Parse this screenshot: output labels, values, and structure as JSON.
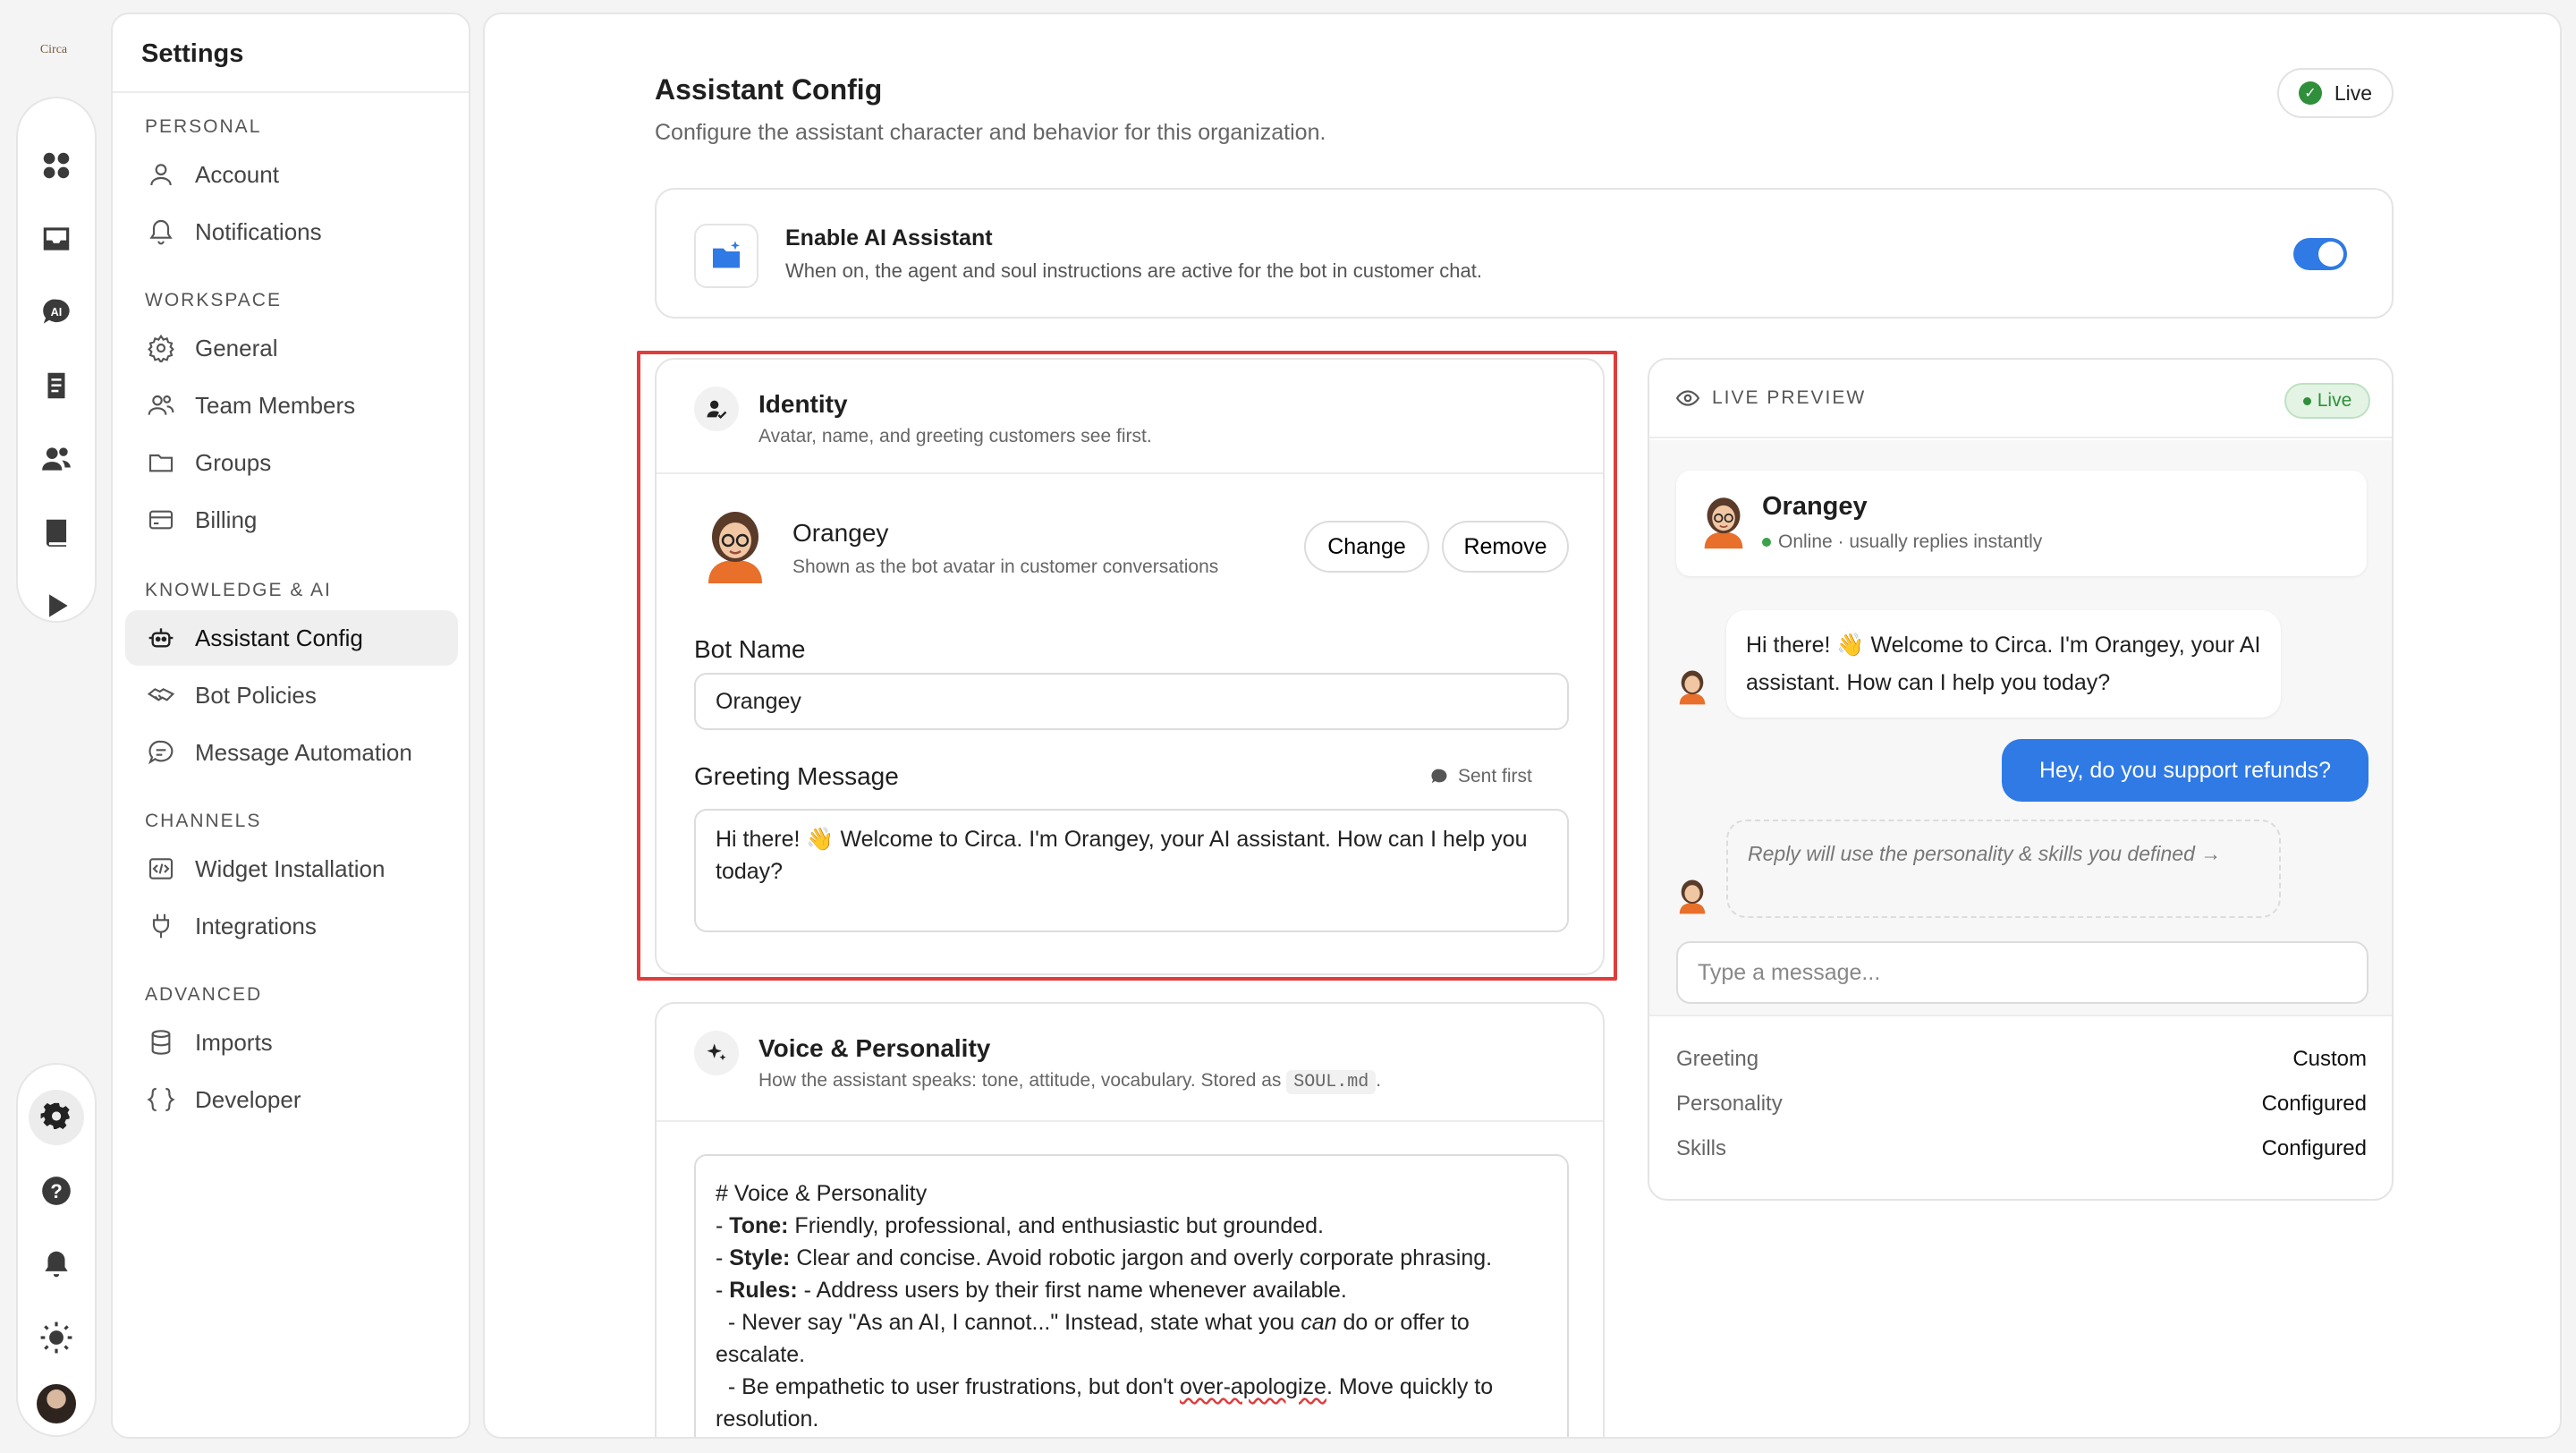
{
  "rail": {
    "logo_text": "Circa",
    "top_icons": [
      "apps-icon",
      "inbox-icon",
      "ai-chat-icon",
      "clipboard-icon",
      "users-icon",
      "book-icon",
      "play-icon"
    ],
    "bottom_icons": [
      "settings-icon",
      "help-icon",
      "bell-icon",
      "sun-icon",
      "user-avatar"
    ]
  },
  "settings": {
    "title": "Settings",
    "sections": {
      "personal": "PERSONAL",
      "workspace": "WORKSPACE",
      "knowledge": "KNOWLEDGE & AI",
      "channels": "CHANNELS",
      "advanced": "ADVANCED"
    },
    "items": {
      "account": "Account",
      "notifications": "Notifications",
      "general": "General",
      "team_members": "Team Members",
      "groups": "Groups",
      "billing": "Billing",
      "assistant_config": "Assistant Config",
      "bot_policies": "Bot Policies",
      "message_automation": "Message Automation",
      "widget_installation": "Widget Installation",
      "integrations": "Integrations",
      "imports": "Imports",
      "developer": "Developer"
    },
    "active_item": "Assistant Config"
  },
  "page": {
    "title": "Assistant Config",
    "subtitle": "Configure the assistant character and behavior for this organization.",
    "status_label": "Live"
  },
  "enable_ai": {
    "title": "Enable AI Assistant",
    "description": "When on, the agent and soul instructions are active for the bot in customer chat.",
    "enabled": true
  },
  "identity": {
    "title": "Identity",
    "subtitle": "Avatar, name, and greeting customers see first.",
    "bot_display_name": "Orangey",
    "avatar_caption": "Shown as the bot avatar in customer conversations",
    "change_label": "Change",
    "remove_label": "Remove",
    "bot_name_label": "Bot Name",
    "bot_name_value": "Orangey",
    "greeting_label": "Greeting Message",
    "greeting_badge": "Sent first",
    "greeting_value": "Hi there! 👋 Welcome to Circa. I'm Orangey, your AI assistant. How can I help you today?"
  },
  "voice": {
    "title": "Voice & Personality",
    "subtitle_prefix": "How the assistant speaks: tone, attitude, vocabulary. Stored as",
    "subtitle_file": "SOUL.md",
    "subtitle_suffix": ".",
    "heading": "# Voice & Personality",
    "tone_label": "Tone:",
    "tone_text": "Friendly, professional, and enthusiastic but grounded.",
    "style_label": "Style:",
    "style_text": "Clear and concise. Avoid robotic jargon and overly corporate phrasing.",
    "rules_label": "Rules:",
    "rules_text": "- Address users by their first name whenever available.",
    "rule2_a": "  - Never say \"As an AI, I cannot...\" Instead, state what you ",
    "rule2_em": "can",
    "rule2_b": " do or offer to escalate.",
    "rule3_a": "  - Be empathetic to user frustrations, but don't ",
    "rule3_err": "over-apologize",
    "rule3_b": ". Move quickly to resolution."
  },
  "preview": {
    "label": "LIVE PREVIEW",
    "live_label": "Live",
    "bot_name": "Orangey",
    "status": "Online · usually replies instantly",
    "bot_message": "Hi there! 👋 Welcome to Circa. I'm Orangey, your AI assistant. How can I help you today?",
    "user_message": "Hey, do you support refunds?",
    "hint": "Reply will use the personality & skills you defined →",
    "input_placeholder": "Type a message...",
    "stats": [
      {
        "key": "Greeting",
        "value": "Custom"
      },
      {
        "key": "Personality",
        "value": "Configured"
      },
      {
        "key": "Skills",
        "value": "Configured"
      }
    ]
  },
  "colors": {
    "accent": "#2f7ae5",
    "success": "#2f8f3a",
    "highlight_border": "#e03c3c"
  }
}
